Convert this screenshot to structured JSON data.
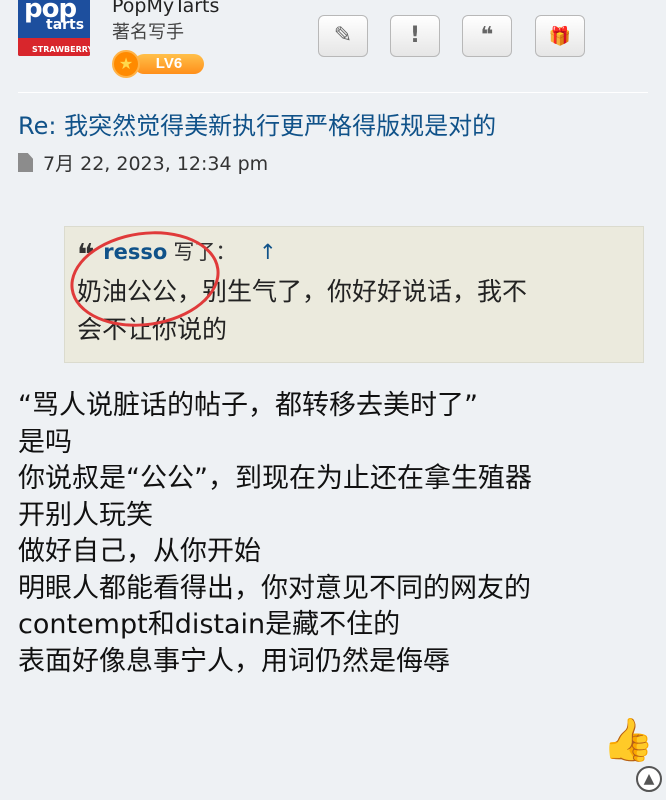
{
  "user": {
    "avatar_text": [
      "pop",
      "tarts",
      "STRAWBERRY"
    ],
    "name": "PopMyTarts",
    "title": "著名写手",
    "rank_label": "LV6"
  },
  "toolbar": {
    "buttons": [
      {
        "name": "edit",
        "icon": "pencil-icon",
        "glyph": "✎"
      },
      {
        "name": "report",
        "icon": "exclamation-icon",
        "glyph": "!"
      },
      {
        "name": "quote",
        "icon": "quote-icon",
        "glyph": "❝"
      },
      {
        "name": "gift",
        "icon": "gift-icon",
        "glyph": "🎁"
      }
    ]
  },
  "post": {
    "title": "Re: 我突然觉得美新执行更严格得版规是对的",
    "date": "7月 22, 2023, 12:34 pm",
    "quote": {
      "author": "resso",
      "wrote": "写了：",
      "arrow": "↑",
      "lines": [
        "奶油公公，别生气了，你好好说话，我不",
        "会不让你说的"
      ]
    },
    "body_lines": [
      "“骂人说脏话的帖子，都转移去美时了”",
      "是吗",
      "你说叔是“公公”，到现在为止还在拿生殖器",
      "开别人玩笑",
      "做好自己，从你开始",
      "明眼人都能看得出，你对意见不同的网友的",
      "contempt和distain是藏不住的",
      "表面好像息事宁人，用词仍然是侮辱"
    ]
  },
  "reaction": "👍",
  "scroll_top_glyph": "▲",
  "colors": {
    "link": "#105289",
    "background": "#eef1f4",
    "quote_bg": "#ebeadd",
    "circle": "#e03a3a"
  }
}
